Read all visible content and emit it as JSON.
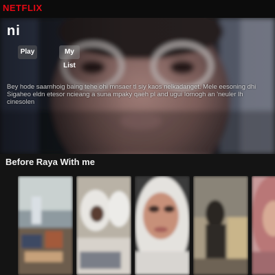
{
  "app": {
    "logo_text": "NETFLIX"
  },
  "hero": {
    "title": "ni",
    "play_label": "Play",
    "list_label": "My List",
    "description": "Bey hode saarnhoig baing tehe ohi mnsaer tl siy kaos nelkadanget. Mele eesoning dhi Sigaheo eldn etesor ncieang a suna mpaky qaeh pl and ugui Iomogh an 'neuler lh cinesolen"
  },
  "row": {
    "title": "Before Raya With me",
    "items": [
      {
        "name": "classroom-scene"
      },
      {
        "name": "students-scene"
      },
      {
        "name": "selfie-portrait"
      },
      {
        "name": "mirror-selfie"
      },
      {
        "name": "pink-hijab-portrait"
      }
    ]
  },
  "colors": {
    "brand": "#e50914",
    "background": "#141414"
  }
}
